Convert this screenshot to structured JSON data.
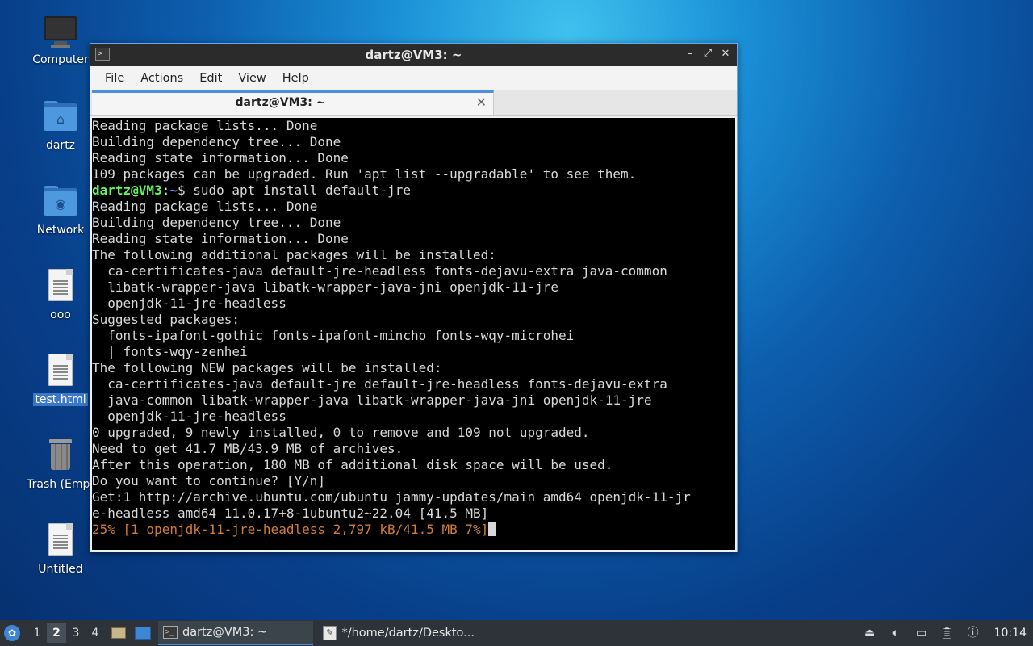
{
  "desktop": {
    "icons": [
      {
        "label": "Computer",
        "type": "monitor"
      },
      {
        "label": "dartz",
        "type": "home-folder"
      },
      {
        "label": "Network",
        "type": "network-folder"
      },
      {
        "label": "ooo",
        "type": "document"
      },
      {
        "label": "test.html",
        "type": "document",
        "selected": true
      },
      {
        "label": "Trash (Empt",
        "type": "trash"
      },
      {
        "label": "Untitled",
        "type": "document"
      }
    ]
  },
  "window": {
    "title": "dartz@VM3: ~",
    "menu": [
      "File",
      "Actions",
      "Edit",
      "View",
      "Help"
    ],
    "tab_title": "dartz@VM3: ~",
    "terminal_lines": [
      "Reading package lists... Done",
      "Building dependency tree... Done",
      "Reading state information... Done",
      "109 packages can be upgraded. Run 'apt list --upgradable' to see them.",
      "Reading package lists... Done",
      "Building dependency tree... Done",
      "Reading state information... Done",
      "The following additional packages will be installed:",
      "  ca-certificates-java default-jre-headless fonts-dejavu-extra java-common",
      "  libatk-wrapper-java libatk-wrapper-java-jni openjdk-11-jre",
      "  openjdk-11-jre-headless",
      "Suggested packages:",
      "  fonts-ipafont-gothic fonts-ipafont-mincho fonts-wqy-microhei",
      "  | fonts-wqy-zenhei",
      "The following NEW packages will be installed:",
      "  ca-certificates-java default-jre default-jre-headless fonts-dejavu-extra",
      "  java-common libatk-wrapper-java libatk-wrapper-java-jni openjdk-11-jre",
      "  openjdk-11-jre-headless",
      "0 upgraded, 9 newly installed, 0 to remove and 109 not upgraded.",
      "Need to get 41.7 MB/43.9 MB of archives.",
      "After this operation, 180 MB of additional disk space will be used.",
      "Do you want to continue? [Y/n]",
      "Get:1 http://archive.ubuntu.com/ubuntu jammy-updates/main amd64 openjdk-11-jr",
      "e-headless amd64 11.0.17+8-1ubuntu2~22.04 [41.5 MB]"
    ],
    "prompt": {
      "user": "dartz@VM3",
      "sep": ":",
      "path": "~",
      "symbol": "$ ",
      "command": "sudo apt install default-jre"
    },
    "progress_line": "25% [1 openjdk-11-jre-headless 2,797 kB/41.5 MB 7%]"
  },
  "taskbar": {
    "workspaces": [
      "1",
      "2",
      "3",
      "4"
    ],
    "active_workspace": "2",
    "tasks": [
      {
        "label": "dartz@VM3: ~",
        "active": true
      },
      {
        "label": "*/home/dartz/Deskto...",
        "active": false
      }
    ],
    "clock": "10:14"
  },
  "colors": {
    "prompt_user": "#5ff85f",
    "prompt_path": "#6a8fff",
    "progress": "#d17d3a",
    "accent": "#4a8fe0"
  }
}
